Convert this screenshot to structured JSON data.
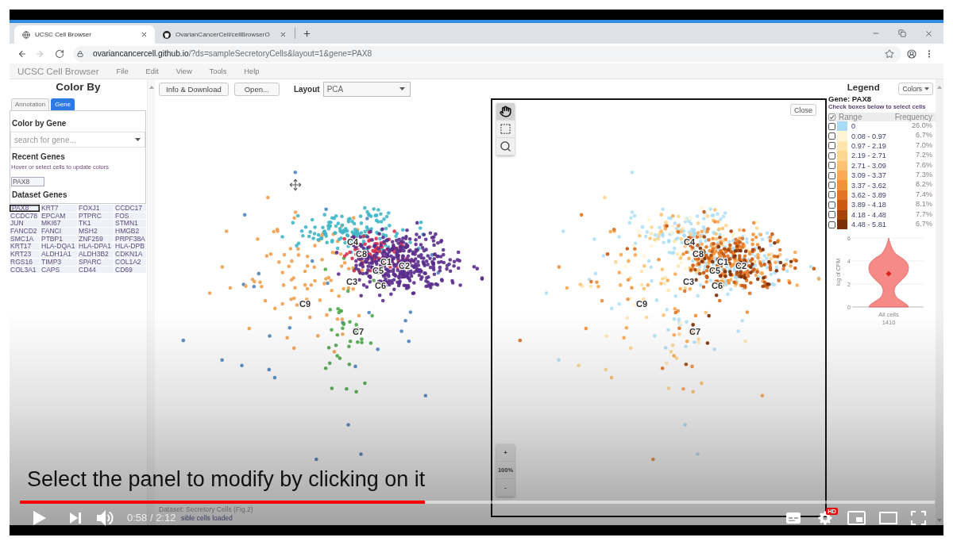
{
  "browser": {
    "tabs": [
      {
        "title": "UCSC Cell Browser",
        "selected": true
      },
      {
        "title": "OvarianCancerCell/cellBrowserO",
        "selected": false
      }
    ],
    "forward_disabled": true,
    "url_host": "ovariancancercell.github.io",
    "url_path": "/?ds=sampleSecretoryCells&layout=1&gene=PAX8"
  },
  "app_menu": {
    "title": "UCSC Cell Browser",
    "items": [
      "File",
      "Edit",
      "View",
      "Tools",
      "Help"
    ]
  },
  "color_by": {
    "title": "Color By",
    "tabs": [
      {
        "label": "Annotation",
        "selected": false
      },
      {
        "label": "Gene",
        "selected": true
      }
    ],
    "section_title": "Color by Gene",
    "search": {
      "placeholder": "search for gene..."
    },
    "recent_title": "Recent Genes",
    "hint": "Hover or select cells to update colors",
    "recent_genes": [
      "PAX8"
    ],
    "dataset_title": "Dataset Genes",
    "dataset_genes": [
      {
        "name": "PAX8",
        "selected": true
      },
      {
        "name": "KRT7",
        "selected": false
      },
      {
        "name": "FOXJ1",
        "selected": false
      },
      {
        "name": "CCDC17",
        "selected": false
      },
      {
        "name": "CCDC78",
        "selected": false
      },
      {
        "name": "EPCAM",
        "selected": false
      },
      {
        "name": "PTPRC",
        "selected": false
      },
      {
        "name": "FOS",
        "selected": false
      },
      {
        "name": "JUN",
        "selected": false
      },
      {
        "name": "MKI67",
        "selected": false
      },
      {
        "name": "TK1",
        "selected": false
      },
      {
        "name": "STMN1",
        "selected": false
      },
      {
        "name": "FANCD2",
        "selected": false
      },
      {
        "name": "FANCI",
        "selected": false
      },
      {
        "name": "MSH2",
        "selected": false
      },
      {
        "name": "HMGB2",
        "selected": false
      },
      {
        "name": "SMC1A",
        "selected": false
      },
      {
        "name": "PTBP1",
        "selected": false
      },
      {
        "name": "ZNF259",
        "selected": false
      },
      {
        "name": "PRPF38A",
        "selected": false
      },
      {
        "name": "KRT17",
        "selected": false
      },
      {
        "name": "HLA-DQA1",
        "selected": false
      },
      {
        "name": "HLA-DPA1",
        "selected": false
      },
      {
        "name": "HLA-DPB",
        "selected": false
      },
      {
        "name": "KRT23",
        "selected": false
      },
      {
        "name": "ALDH1A1",
        "selected": false
      },
      {
        "name": "ALDH3B2",
        "selected": false
      },
      {
        "name": "CDKN1A",
        "selected": false
      },
      {
        "name": "RGS16",
        "selected": false
      },
      {
        "name": "TIMP3",
        "selected": false
      },
      {
        "name": "SPARC",
        "selected": false
      },
      {
        "name": "COL1A2",
        "selected": false
      },
      {
        "name": "COL3A1",
        "selected": false
      },
      {
        "name": "CAPS",
        "selected": false
      },
      {
        "name": "CD44",
        "selected": false
      },
      {
        "name": "CD69",
        "selected": false
      }
    ]
  },
  "toolbar": {
    "buttons": [
      "Info & Download",
      "Open..."
    ],
    "layout_label": "Layout",
    "layout_value": "PCA"
  },
  "left_plot": {
    "cluster_labels": [
      "C4",
      "C8",
      "C1",
      "C2",
      "C5",
      "C3",
      "C6",
      "C9",
      "C7"
    ]
  },
  "right_plot": {
    "tools": [
      {
        "kind": "pan",
        "selected": true
      },
      {
        "kind": "select",
        "selected": false
      },
      {
        "kind": "zoom",
        "selected": false
      }
    ],
    "close": "Close",
    "cluster_labels": [
      "C4",
      "C8",
      "C1",
      "C2",
      "C5",
      "C3",
      "C6",
      "C9",
      "C7"
    ],
    "zoom_controls": [
      "+",
      "100%",
      "-"
    ]
  },
  "legend": {
    "title": "Legend",
    "colors_button": "Colors",
    "gene": "Gene: PAX8",
    "hint": "Check boxes below to select cells",
    "header": {
      "checked": true,
      "range": "Range",
      "frequency": "Frequency"
    },
    "rows": [
      {
        "checked": false,
        "color": "#a8dcf6",
        "range": "0",
        "frequency": "26.0%"
      },
      {
        "checked": false,
        "color": "#fff4d4",
        "range": "0.08 - 0.97",
        "frequency": "6.7%"
      },
      {
        "checked": false,
        "color": "#fee6ae",
        "range": "0.97 - 2.19",
        "frequency": "7.0%"
      },
      {
        "checked": false,
        "color": "#fdd690",
        "range": "2.19 - 2.71",
        "frequency": "7.2%"
      },
      {
        "checked": false,
        "color": "#fdc272",
        "range": "2.71 - 3.09",
        "frequency": "7.6%"
      },
      {
        "checked": false,
        "color": "#fca955",
        "range": "3.09 - 3.37",
        "frequency": "7.3%"
      },
      {
        "checked": false,
        "color": "#f3903a",
        "range": "3.37 - 3.62",
        "frequency": "8.2%"
      },
      {
        "checked": false,
        "color": "#e27424",
        "range": "3.62 - 3.89",
        "frequency": "7.4%"
      },
      {
        "checked": false,
        "color": "#ca5a12",
        "range": "3.89 - 4.18",
        "frequency": "8.1%"
      },
      {
        "checked": false,
        "color": "#a6440a",
        "range": "4.18 - 4.48",
        "frequency": "7.7%"
      },
      {
        "checked": false,
        "color": "#7c2e05",
        "range": "4.48 - 5.81",
        "frequency": "6.7%"
      }
    ],
    "violin": {
      "ylabel": "log of CPM",
      "yticks": [
        "6",
        "4",
        "2",
        "0"
      ],
      "xlabel": "All cells",
      "count": "1410"
    }
  },
  "status_bar": {
    "dataset": "Dataset: Secretory Cells (Fig.2)",
    "cells": "sible cells loaded"
  },
  "video": {
    "caption": "Select the panel to modify by clicking on it",
    "progress": {
      "level": 0.443
    },
    "time": "0:58 / 2:12",
    "hd_badge": "HD"
  }
}
